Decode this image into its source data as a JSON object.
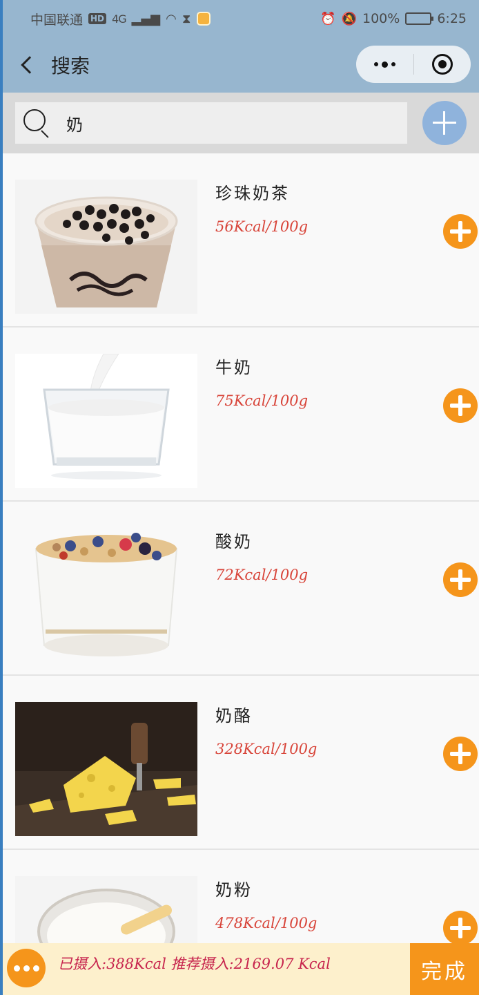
{
  "status_bar": {
    "carrier": "中国联通",
    "hd": "HD",
    "network": "4G",
    "battery_percent": "100%",
    "time": "6:25"
  },
  "nav": {
    "title": "搜索"
  },
  "search": {
    "value": "奶"
  },
  "foods": [
    {
      "name": "珍珠奶茶",
      "kcal": "56Kcal/100g"
    },
    {
      "name": "牛奶",
      "kcal": "75Kcal/100g"
    },
    {
      "name": "酸奶",
      "kcal": "72Kcal/100g"
    },
    {
      "name": "奶酪",
      "kcal": "328Kcal/100g"
    },
    {
      "name": "奶粉",
      "kcal": "478Kcal/100g"
    }
  ],
  "bottom": {
    "intake_text": "已摄入:388Kcal 推荐摄入:2169.07 Kcal",
    "done_label": "完成"
  },
  "colors": {
    "header": "#97b6cf",
    "accent": "#f5951b",
    "kcal": "#d8453a",
    "add_circle": "#8fb3dc"
  }
}
